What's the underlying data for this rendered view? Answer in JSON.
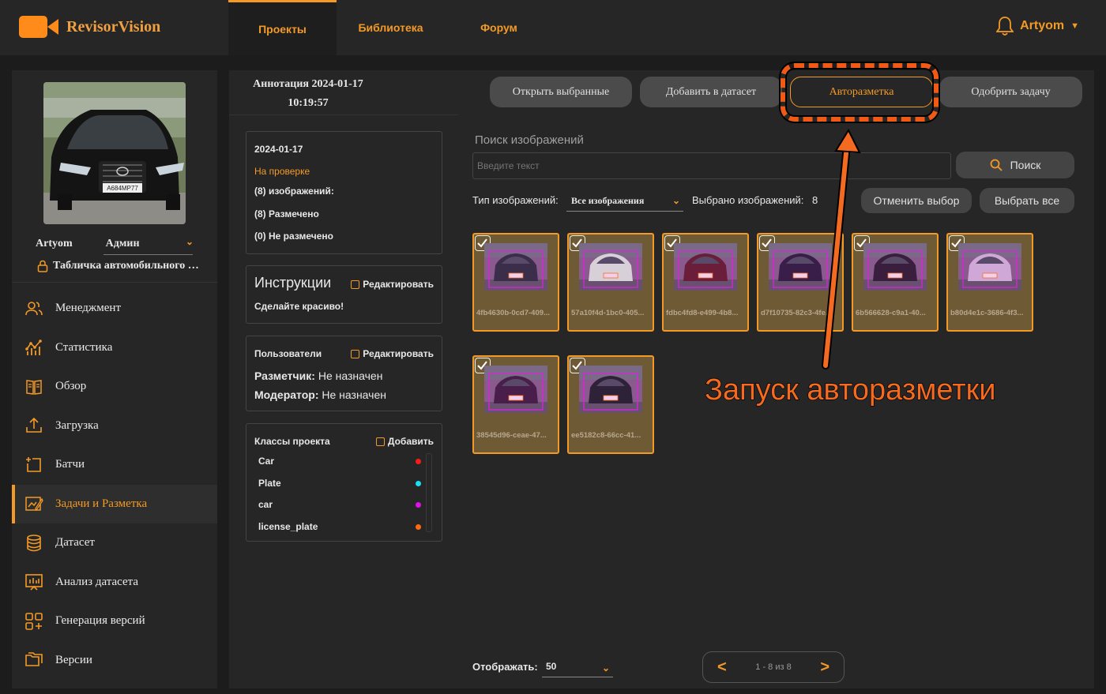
{
  "app": {
    "name": "RevisorVision"
  },
  "nav": {
    "tabs": [
      {
        "label": "Проекты",
        "active": true
      },
      {
        "label": "Библиотека"
      },
      {
        "label": "Форум"
      }
    ]
  },
  "user": {
    "name": "Artyom"
  },
  "sidebar": {
    "username": "Artyom",
    "role": "Админ",
    "project": "Табличка автомобильного номера",
    "items": [
      {
        "label": "Менеджмент",
        "icon": "users-icon"
      },
      {
        "label": "Статистика",
        "icon": "stats-icon"
      },
      {
        "label": "Обзор",
        "icon": "book-icon"
      },
      {
        "label": "Загрузка",
        "icon": "upload-icon"
      },
      {
        "label": "Батчи",
        "icon": "batch-add-icon"
      },
      {
        "label": "Задачи и Разметка",
        "icon": "annotate-icon",
        "active": true
      },
      {
        "label": "Датасет",
        "icon": "database-icon"
      },
      {
        "label": "Анализ датасета",
        "icon": "chart-analysis-icon"
      },
      {
        "label": "Генерация версий",
        "icon": "grid-plus-icon"
      },
      {
        "label": "Версии",
        "icon": "folders-icon"
      }
    ]
  },
  "task": {
    "title_line1": "Аннотация 2024-01-17",
    "title_line2": "10:19:57"
  },
  "toolbar": {
    "open_selected": "Открыть выбранные",
    "add_dataset": "Добавить в датасет",
    "auto_annotate": "Авторазметка",
    "approve": "Одобрить задачу"
  },
  "info": {
    "date": "2024-01-17",
    "status": "На проверке",
    "images": "(8) изображений:",
    "annotated": "(8) Размечено",
    "not_annotated": "(0) Не размечено"
  },
  "instructions": {
    "title": "Инструкции",
    "edit": "Редактировать",
    "text": "Сделайте красиво!"
  },
  "users": {
    "title": "Пользователи",
    "edit": "Редактировать",
    "annotator_label": "Разметчик:",
    "annotator_value": "Не назначен",
    "moderator_label": "Модератор:",
    "moderator_value": "Не назначен"
  },
  "classes": {
    "title": "Классы проекта",
    "add": "Добавить",
    "items": [
      {
        "name": "Car",
        "color": "#ff1a1a"
      },
      {
        "name": "Plate",
        "color": "#19e0f0"
      },
      {
        "name": "car",
        "color": "#e010e8"
      },
      {
        "name": "license_plate",
        "color": "#ff6a10"
      }
    ]
  },
  "search": {
    "label": "Поиск изображений",
    "placeholder": "Введите текст",
    "button": "Поиск"
  },
  "filter": {
    "type_label": "Тип изображений:",
    "type_value": "Все изображения",
    "selected_label": "Выбрано изображений:",
    "selected_count": "8"
  },
  "selection": {
    "cancel": "Отменить выбор",
    "select_all": "Выбрать все"
  },
  "images": [
    {
      "name": "4fb4630b-0cd7-409...",
      "car": "#3a2e4a"
    },
    {
      "name": "57a10f4d-1bc0-405...",
      "car": "#d8d0d8"
    },
    {
      "name": "fdbc4fd8-e499-4b8...",
      "car": "#6a1e3a"
    },
    {
      "name": "d7f10735-82c3-4fe...",
      "car": "#3a1e4a"
    },
    {
      "name": "6b566628-c9a1-40...",
      "car": "#3a1e3e"
    },
    {
      "name": "b80d4e1c-3686-4f3...",
      "car": "#d0a8d8"
    },
    {
      "name": "38545d96-ceae-47...",
      "car": "#4a1e4a"
    },
    {
      "name": "ee5182c8-66cc-41...",
      "car": "#2e2238"
    }
  ],
  "annotation": {
    "text": "Запуск авторазметки",
    "color": "#f36a20"
  },
  "pagination": {
    "label": "Отображать:",
    "per_page": "50",
    "range": "1 - 8 из 8"
  }
}
